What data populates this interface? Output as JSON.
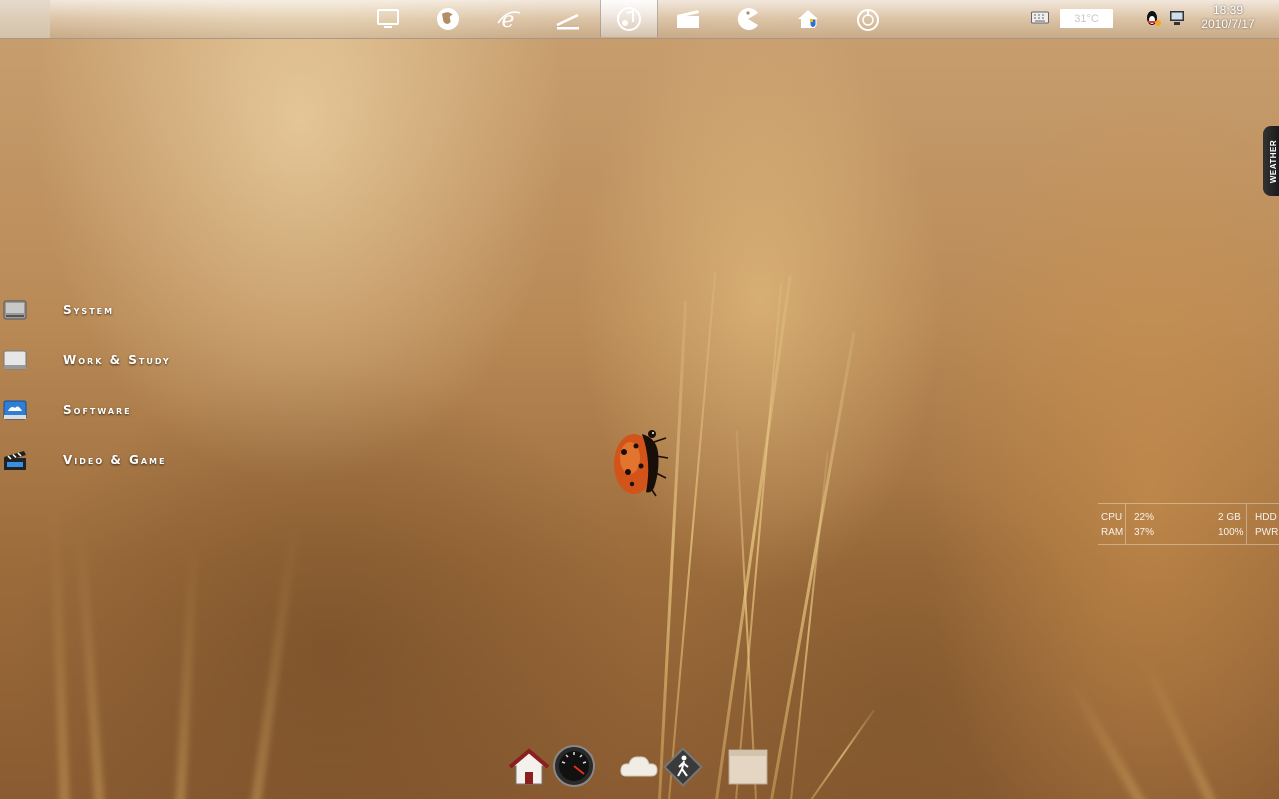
{
  "topbar": {
    "apps": [
      {
        "icon": "monitor-icon",
        "name": "monitor-button"
      },
      {
        "icon": "firefox-icon",
        "name": "firefox-button"
      },
      {
        "icon": "internet-explorer-icon",
        "name": "ie-button"
      },
      {
        "icon": "pen-icon",
        "name": "pen-button"
      },
      {
        "icon": "music-icon",
        "name": "music-button",
        "active": true
      },
      {
        "icon": "clapperboard-icon",
        "name": "video-button"
      },
      {
        "icon": "pacman-icon",
        "name": "game-button"
      },
      {
        "icon": "home-shield-icon",
        "name": "home-shield-button"
      },
      {
        "icon": "power-icon",
        "name": "power-button"
      }
    ],
    "weather_temp": "31°C",
    "clock_time": "18:39",
    "clock_date": "2010/7/17"
  },
  "weather_tab": {
    "label": "WEATHER"
  },
  "left_menu": [
    {
      "label": "System",
      "icon": "disk-drive-icon"
    },
    {
      "label": "Work & Study",
      "icon": "document-drive-icon"
    },
    {
      "label": "Software",
      "icon": "software-drive-icon"
    },
    {
      "label": "Video & Game",
      "icon": "clapperboard-icon"
    }
  ],
  "sysmon": {
    "cpu_label": "CPU",
    "cpu_value": "22%",
    "ram_label": "RAM",
    "ram_value": "37%",
    "hdd_value": "2 GB",
    "hdd_label": "HDD",
    "pwr_value": "100%",
    "pwr_label": "PWR"
  },
  "bottom_dock": [
    {
      "icon": "house-icon"
    },
    {
      "icon": "speedometer-icon"
    },
    {
      "icon": "cloud-icon"
    },
    {
      "icon": "walking-sign-icon"
    },
    {
      "icon": "box-icon"
    }
  ]
}
